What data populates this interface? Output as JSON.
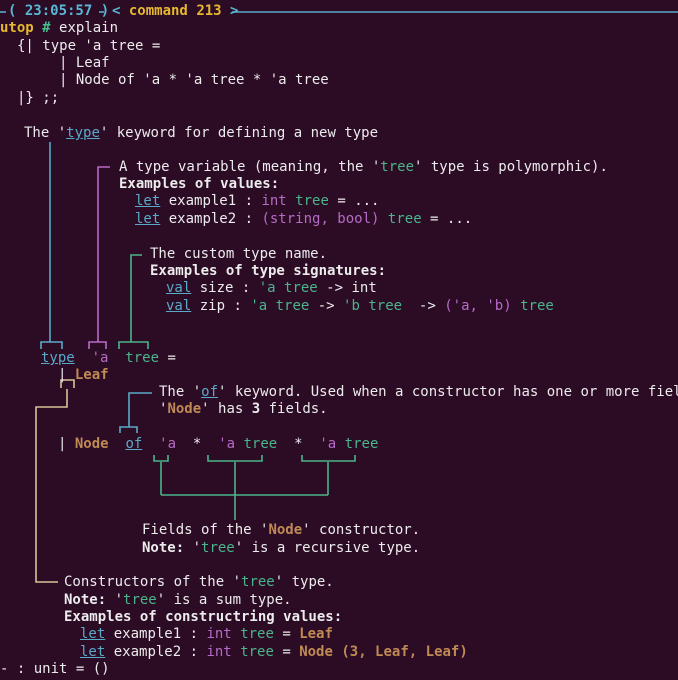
{
  "prompt": {
    "time": "23:05:57",
    "command_label": "command",
    "command_number": "213",
    "name": "utop",
    "hash": "#",
    "input": "explain"
  },
  "code": {
    "line1": "{| type 'a tree =",
    "line2": "| Leaf",
    "line3": "| Node of 'a * 'a tree * 'a tree",
    "line4": "|} ;;"
  },
  "notes": {
    "type_kw": {
      "pre": "The '",
      "kw": "type",
      "post": "' keyword for defining a new type"
    },
    "type_var": {
      "pre": "A type variable (meaning, the '",
      "name": "tree",
      "post": "' type is polymorphic).",
      "examples_label": "Examples of values:",
      "ex1_kw": "let",
      "ex1_name": " example1 : ",
      "ex1_type": "int",
      "ex1_tree": "tree",
      "ex1_rest": " = ...",
      "ex2_kw": "let",
      "ex2_name": " example2 : ",
      "ex2_type": "(string, bool)",
      "ex2_tree": "tree",
      "ex2_rest": " = ..."
    },
    "custom_name": {
      "title": "The custom type name.",
      "examples_label": "Examples of type signatures:",
      "sig1_kw": "val",
      "sig1_name": " size : ",
      "sig1_type": "'a tree",
      "sig1_rest": " -> int",
      "sig2_kw": "val",
      "sig2_name": " zip : ",
      "sig2_a": "'a tree",
      "sig2_arrow1": " -> ",
      "sig2_b": "'b tree",
      "sig2_arrow2": "  -> ",
      "sig2_pair": "('a, 'b)",
      "sig2_tree": "tree"
    },
    "of_kw": {
      "pre": "The '",
      "kw": "of",
      "post": "' keyword. Used when a constructor has one or more fields.",
      "node_q1": "'",
      "node": "Node",
      "node_q2": "' has ",
      "count": "3",
      "node_post": " fields."
    },
    "fields": {
      "pre": "Fields of the '",
      "node": "Node",
      "post": "' constructor.",
      "note_label": "Note:",
      "note_pre": " '",
      "note_tree": "tree",
      "note_post": "' is a recursive type."
    },
    "constructors": {
      "pre": "Constructors of the '",
      "tree": "tree",
      "post": "' type.",
      "note_label": "Note:",
      "note_pre": " '",
      "note_tree": "tree",
      "note_post": "' is a sum type.",
      "examples_label": "Examples of constructring values:",
      "ex1_kw": "let",
      "ex1_name": " example1 : ",
      "ex1_type": "int",
      "ex1_tree": "tree",
      "ex1_eq": " = ",
      "ex1_val": "Leaf",
      "ex2_kw": "let",
      "ex2_name": " example2 : ",
      "ex2_type": "int",
      "ex2_tree": "tree",
      "ex2_eq": " = ",
      "ex2_val": "Node (3, Leaf, Leaf)"
    }
  },
  "diagram": {
    "type_kw": "type",
    "tvar": "'a",
    "tname": "tree",
    "eq": " =",
    "bar1": "|",
    "leaf": "Leaf",
    "bar2": "|",
    "node": "Node",
    "of": "of",
    "f1": "'a",
    "star1": "*",
    "f2_var": "'a",
    "f2_tree": "tree",
    "star2": "*",
    "f3_var": "'a",
    "f3_tree": "tree"
  },
  "result": "- : unit = ()",
  "colors": {
    "background": "#2c0b25",
    "prompt_line": "#5aa9c9",
    "time": "#5aa9c9",
    "command": "#e5b830",
    "hash": "#46c08e",
    "type_var": "#b66bc6",
    "type_name": "#4ab58a",
    "constructor": "#c08a55"
  }
}
